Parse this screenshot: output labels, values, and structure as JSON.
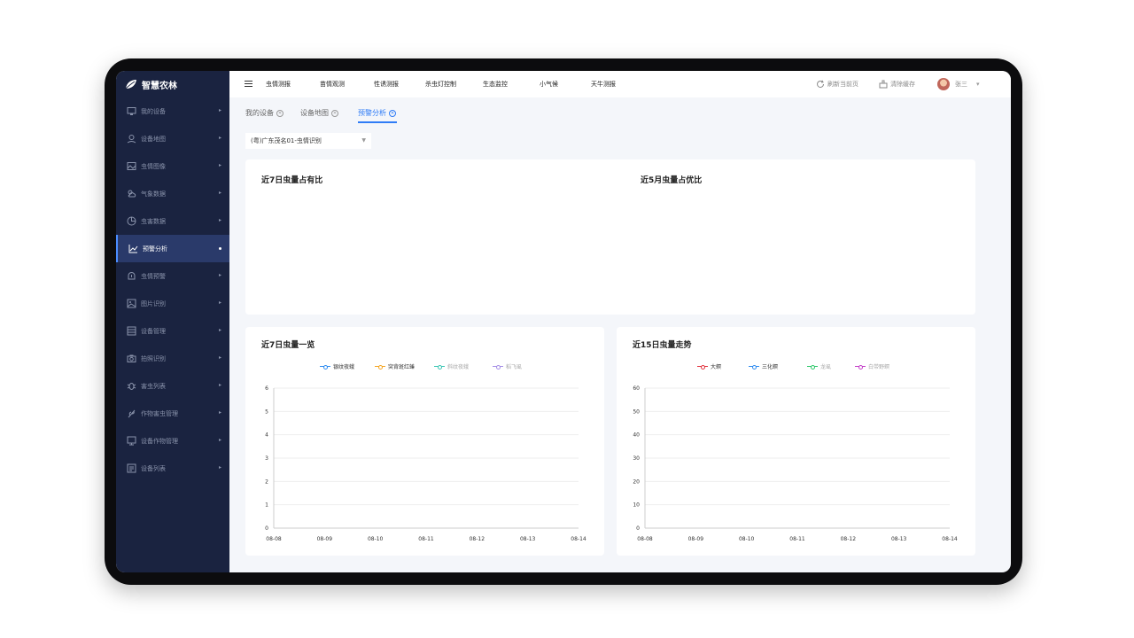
{
  "app": {
    "name": "智慧农林"
  },
  "sidebar": {
    "items": [
      {
        "label": "我的设备",
        "icon": "monitor-icon",
        "active": false
      },
      {
        "label": "设备地图",
        "icon": "map-pin-icon",
        "active": false
      },
      {
        "label": "虫情图像",
        "icon": "image-icon",
        "active": false
      },
      {
        "label": "气象数据",
        "icon": "weather-icon",
        "active": false
      },
      {
        "label": "虫害数据",
        "icon": "pie-chart-icon",
        "active": false
      },
      {
        "label": "预警分析",
        "icon": "line-chart-icon",
        "active": true
      },
      {
        "label": "虫情预警",
        "icon": "alert-icon",
        "active": false
      },
      {
        "label": "图片识别",
        "icon": "picture-icon",
        "active": false
      },
      {
        "label": "设备管理",
        "icon": "device-list-icon",
        "active": false
      },
      {
        "label": "拍照识别",
        "icon": "camera-icon",
        "active": false
      },
      {
        "label": "害虫列表",
        "icon": "bug-icon",
        "active": false
      },
      {
        "label": "作物害虫管理",
        "icon": "plant-icon",
        "active": false
      },
      {
        "label": "设备作物管理",
        "icon": "desktop-icon",
        "active": false
      },
      {
        "label": "设备列表",
        "icon": "list-icon",
        "active": false
      }
    ]
  },
  "topbar": {
    "tabs": [
      "虫情测报",
      "苗情观测",
      "性诱测报",
      "杀虫灯控制",
      "生态监控",
      "小气候",
      "天牛测报"
    ],
    "refresh_label": "刷新当前页",
    "clear_cache_label": "清除缓存",
    "user_name": "张三"
  },
  "page_tabs": [
    {
      "label": "我的设备",
      "active": false
    },
    {
      "label": "设备地图",
      "active": false
    },
    {
      "label": "预警分析",
      "active": true
    }
  ],
  "device_select": {
    "value": "(粤)广东茂名01-虫情识别"
  },
  "cards": {
    "ratio7_title": "近7日虫量占有比",
    "ratio5_title": "近5月虫量占优比",
    "overview7_title": "近7日虫量一览",
    "trend15_title": "近15日虫量走势"
  },
  "colors": {
    "accent": "#2f7cf6",
    "sidebar_bg": "#1a2340",
    "active_bg": "#2a3a6a"
  },
  "chart_data": [
    {
      "type": "line",
      "title": "近7日虫量一览",
      "x": [
        "08-08",
        "08-09",
        "08-10",
        "08-11",
        "08-12",
        "08-13",
        "08-14"
      ],
      "ylim": [
        0,
        6
      ],
      "yticks": [
        0,
        1,
        2,
        3,
        4,
        5,
        6
      ],
      "grid": true,
      "legend": "top-center",
      "series": [
        {
          "name": "银纹夜蛾",
          "color": "#2f8cf0",
          "values": [],
          "enabled": true
        },
        {
          "name": "突背斑红蝽",
          "color": "#f5a623",
          "values": [],
          "enabled": true
        },
        {
          "name": "斜纹夜蛾",
          "color": "#3bc6b4",
          "values": [],
          "enabled": false
        },
        {
          "name": "稻飞虱",
          "color": "#a58ee6",
          "values": [],
          "enabled": false
        }
      ]
    },
    {
      "type": "line",
      "title": "近15日虫量走势",
      "x": [
        "08-08",
        "08-09",
        "08-10",
        "08-11",
        "08-12",
        "08-13",
        "08-14"
      ],
      "ylim": [
        0,
        60
      ],
      "yticks": [
        0,
        10,
        20,
        30,
        40,
        50,
        60
      ],
      "grid": true,
      "legend": "top-center",
      "series": [
        {
          "name": "大螟",
          "color": "#e2343f",
          "values": [],
          "enabled": true
        },
        {
          "name": "三化螟",
          "color": "#2f8cf0",
          "values": [],
          "enabled": true
        },
        {
          "name": "龙虱",
          "color": "#2ec76a",
          "values": [],
          "enabled": false
        },
        {
          "name": "白带野螟",
          "color": "#c43fc8",
          "values": [],
          "enabled": false
        }
      ]
    }
  ]
}
